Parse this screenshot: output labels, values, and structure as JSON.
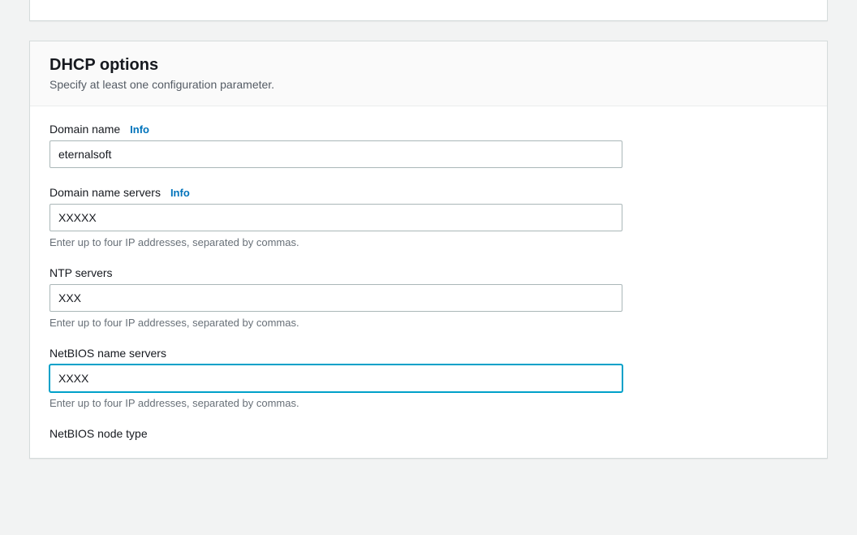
{
  "panel": {
    "title": "DHCP options",
    "subtitle": "Specify at least one configuration parameter.",
    "info_label": "Info"
  },
  "fields": {
    "domain_name": {
      "label": "Domain name",
      "value": "eternalsoft",
      "has_info": true
    },
    "domain_name_servers": {
      "label": "Domain name servers",
      "value": "XXXXX",
      "hint": "Enter up to four IP addresses, separated by commas.",
      "has_info": true
    },
    "ntp_servers": {
      "label": "NTP servers",
      "value": "XXX",
      "hint": "Enter up to four IP addresses, separated by commas.",
      "has_info": false
    },
    "netbios_name_servers": {
      "label": "NetBIOS name servers",
      "value": "XXXX",
      "hint": "Enter up to four IP addresses, separated by commas.",
      "has_info": false
    },
    "netbios_node_type": {
      "label": "NetBIOS node type",
      "has_info": false
    }
  }
}
